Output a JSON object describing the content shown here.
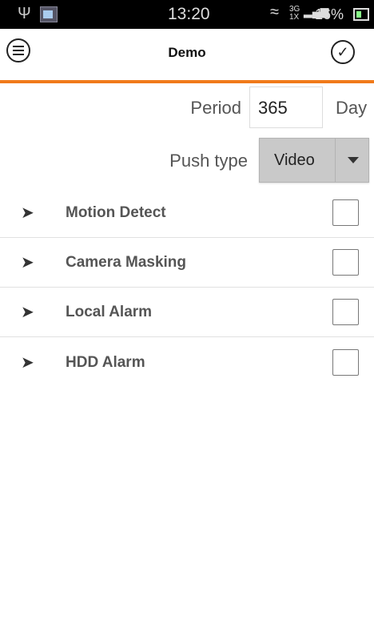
{
  "status_bar": {
    "time": "13:20",
    "network_top": "3G",
    "network_bottom": "1X",
    "battery": "16%",
    "icons": [
      "usb-icon",
      "image-icon",
      "wifi-icon",
      "signal-icon",
      "battery-icon"
    ]
  },
  "header": {
    "title": "Demo",
    "menu_icon": "menu-icon",
    "confirm_icon": "check-icon",
    "accent_color": "#f07a1a"
  },
  "form": {
    "period_label": "Period",
    "period_value": "365",
    "period_unit": "Day",
    "push_type_label": "Push type",
    "push_type_value": "Video"
  },
  "items": [
    {
      "label": "Motion Detect"
    },
    {
      "label": "Camera Masking"
    },
    {
      "label": "Local Alarm"
    },
    {
      "label": "HDD Alarm"
    }
  ]
}
